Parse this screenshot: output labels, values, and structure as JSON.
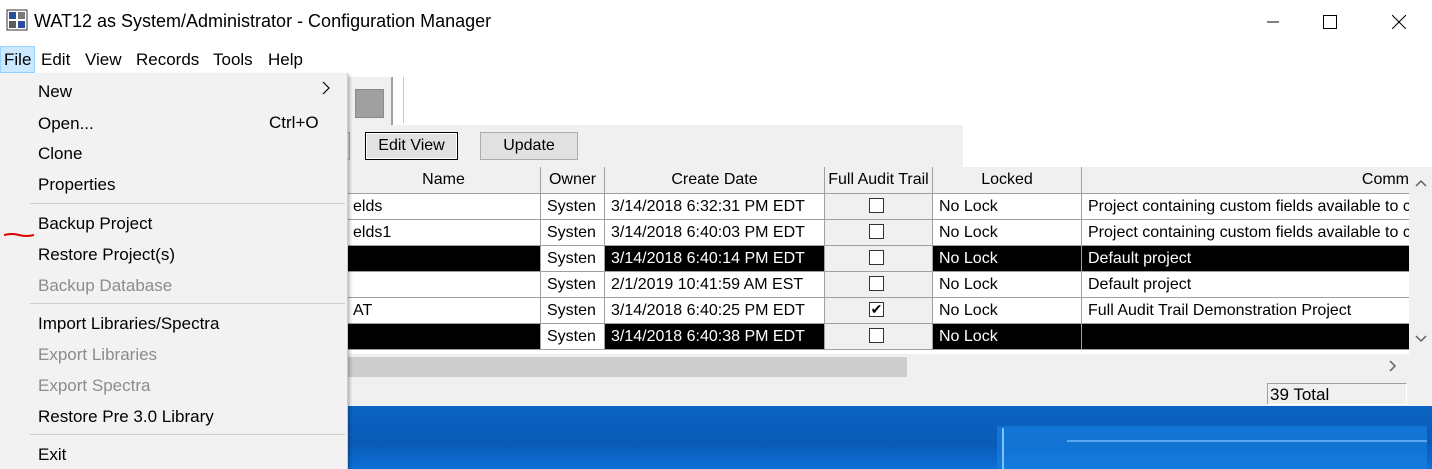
{
  "window": {
    "title": "WAT12 as System/Administrator - Configuration Manager",
    "minimize_icon": "minimize-icon",
    "maximize_icon": "maximize-icon",
    "close_icon": "close-icon"
  },
  "menubar": {
    "file": "File",
    "edit": "Edit",
    "view": "View",
    "records": "Records",
    "tools": "Tools",
    "help": "Help"
  },
  "file_menu": {
    "new": "New",
    "open": "Open...",
    "open_shortcut": "Ctrl+O",
    "clone": "Clone",
    "properties": "Properties",
    "backup_project": "Backup Project",
    "restore_projects": "Restore Project(s)",
    "backup_database": "Backup Database",
    "import_libraries": "Import Libraries/Spectra",
    "export_libraries": "Export Libraries",
    "export_spectra": "Export Spectra",
    "restore_pre30": "Restore Pre 3.0 Library",
    "exit": "Exit",
    "submenu_arrow": ">"
  },
  "buttons": {
    "edit_view": "Edit View",
    "update": "Update"
  },
  "table": {
    "headers": {
      "name": "Name",
      "owner": "Owner",
      "create_date": "Create Date",
      "full_audit_trail": "Full Audit Trail",
      "locked": "Locked",
      "comments": "Comm"
    },
    "rows": [
      {
        "name": "elds",
        "owner": "Systen",
        "date": "3/14/2018 6:32:31 PM EDT",
        "audit": "",
        "locked": "No Lock",
        "comments": "Project containing custom fields available to c",
        "selected": false
      },
      {
        "name": "elds1",
        "owner": "Systen",
        "date": "3/14/2018 6:40:03 PM EDT",
        "audit": "",
        "locked": "No Lock",
        "comments": "Project containing custom fields available to c",
        "selected": false
      },
      {
        "name": "",
        "owner": "Systen",
        "date": "3/14/2018 6:40:14 PM EDT",
        "audit": "",
        "locked": "No Lock",
        "comments": "Default project",
        "selected": true
      },
      {
        "name": "",
        "owner": "Systen",
        "date": "2/1/2019 10:41:59 AM EST",
        "audit": "",
        "locked": "No Lock",
        "comments": "Default project",
        "selected": false
      },
      {
        "name": "AT",
        "owner": "Systen",
        "date": "3/14/2018 6:40:25 PM EDT",
        "audit": "✔",
        "locked": "No Lock",
        "comments": "Full Audit Trail Demonstration Project",
        "selected": false
      },
      {
        "name": "",
        "owner": "Systen",
        "date": "3/14/2018 6:40:38 PM EDT",
        "audit": "",
        "locked": "No Lock",
        "comments": "",
        "selected": true
      }
    ]
  },
  "status": {
    "total": "39 Total"
  },
  "scroll": {
    "up": "^",
    "down": "v",
    "right": ">"
  }
}
